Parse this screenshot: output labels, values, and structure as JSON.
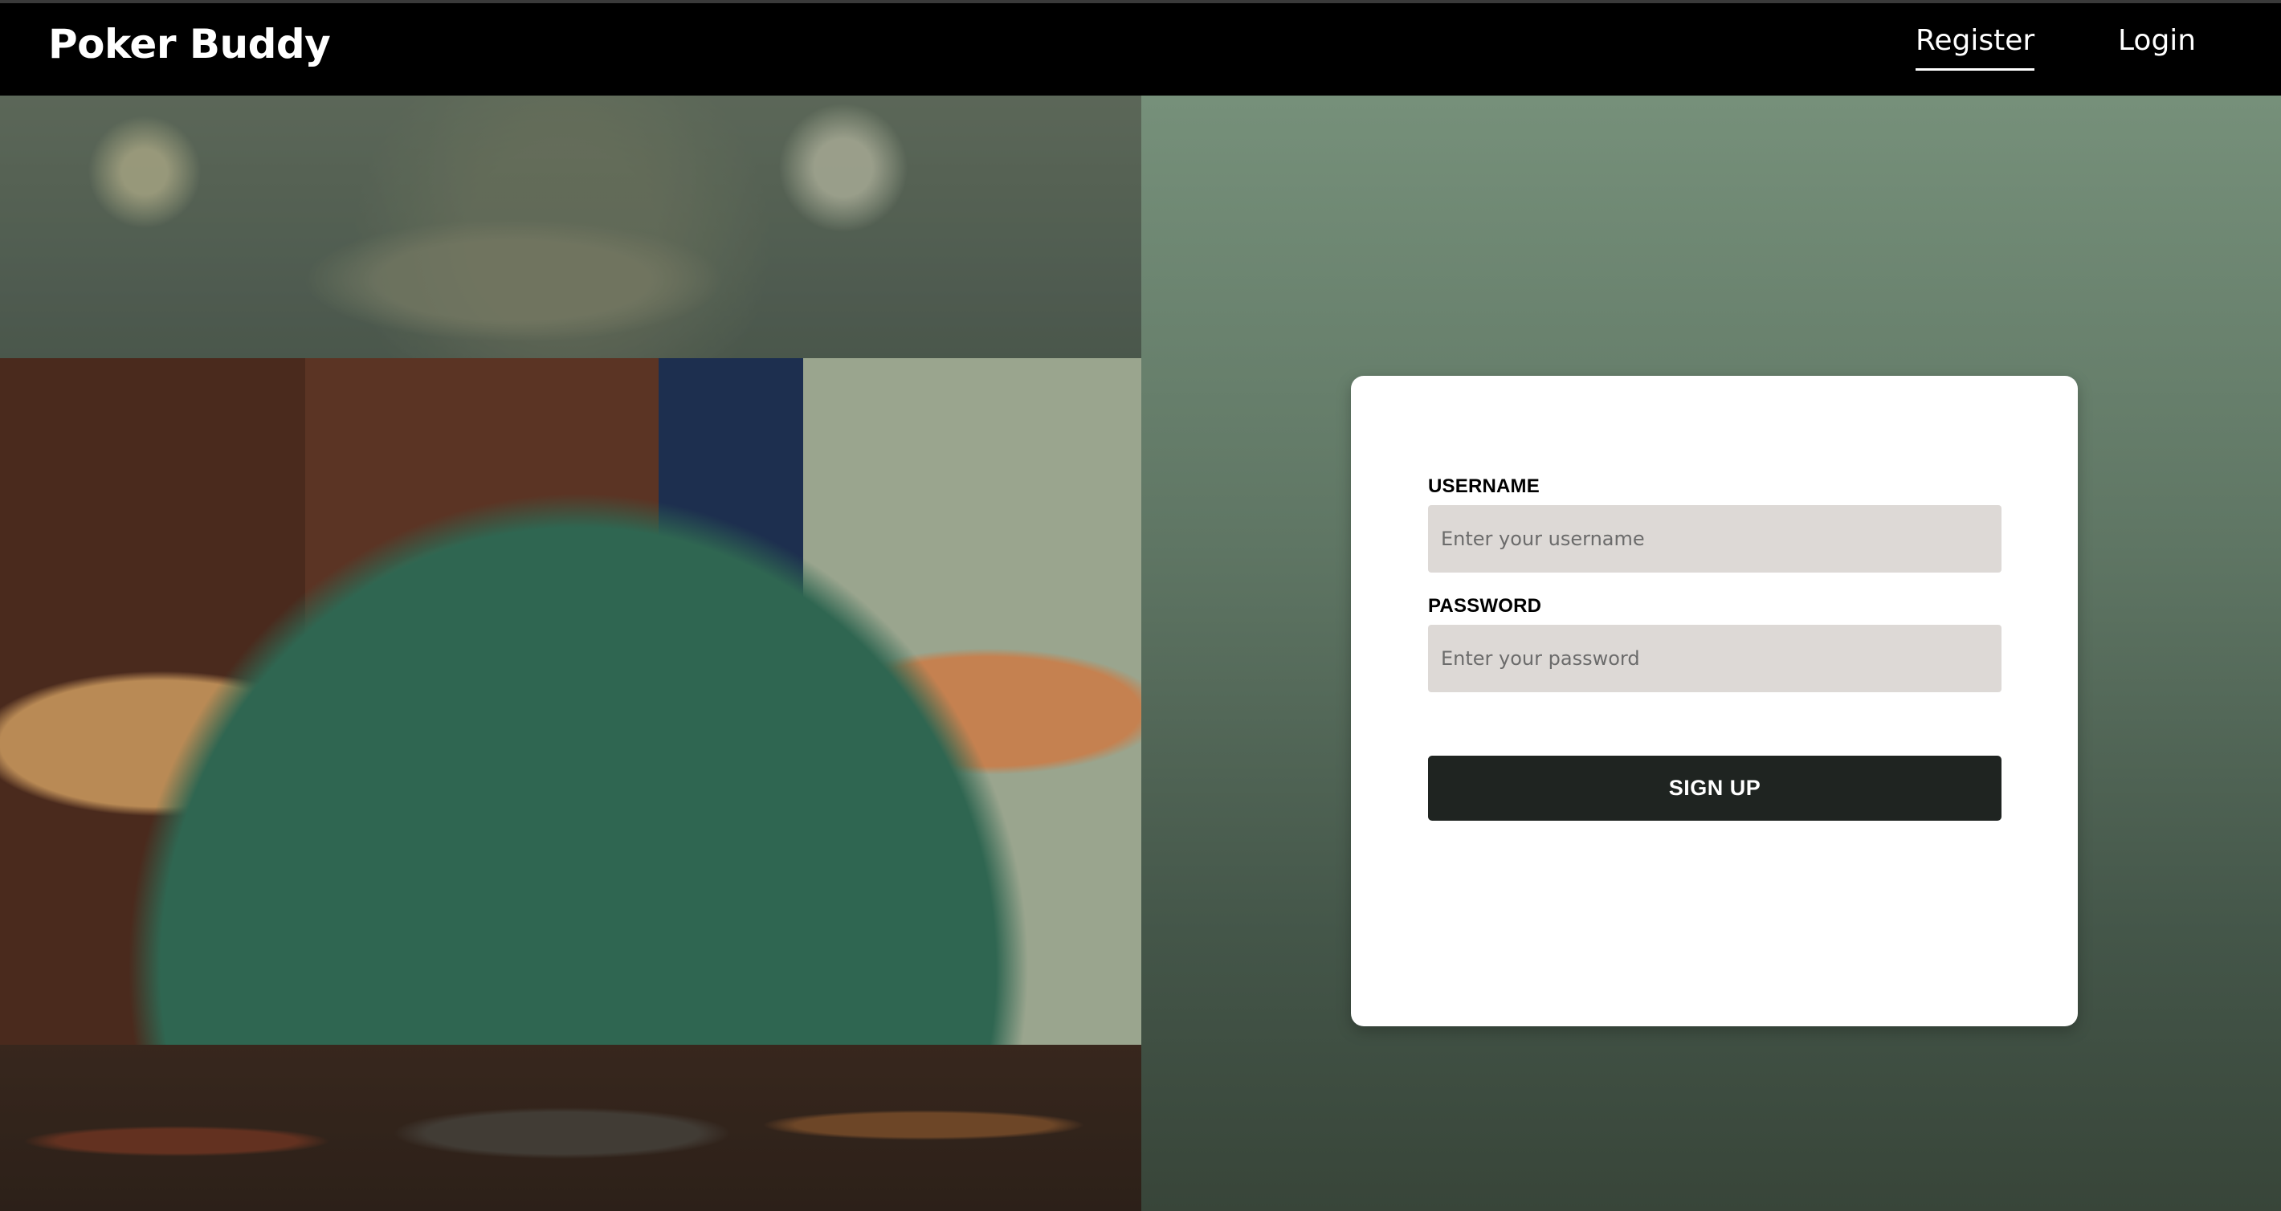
{
  "header": {
    "brand": "Poker Buddy",
    "nav": {
      "register": "Register",
      "login": "Login"
    },
    "active_tab": "Register"
  },
  "hero_images": [
    {
      "name": "cat-portrait-strip"
    },
    {
      "name": "cats-playing-poker-photo"
    },
    {
      "name": "dressed-cats-cards-strip"
    }
  ],
  "form": {
    "username_label": "USERNAME",
    "username_placeholder": "Enter your username",
    "username_value": "",
    "password_label": "PASSWORD",
    "password_placeholder": "Enter your password",
    "password_value": "",
    "submit_label": "SIGN UP"
  },
  "colors": {
    "header_bg": "#000000",
    "panel_gradient_top": "#76907a",
    "panel_gradient_bottom": "#384539",
    "input_bg": "#ddd9d6",
    "button_bg": "#1f2421"
  }
}
